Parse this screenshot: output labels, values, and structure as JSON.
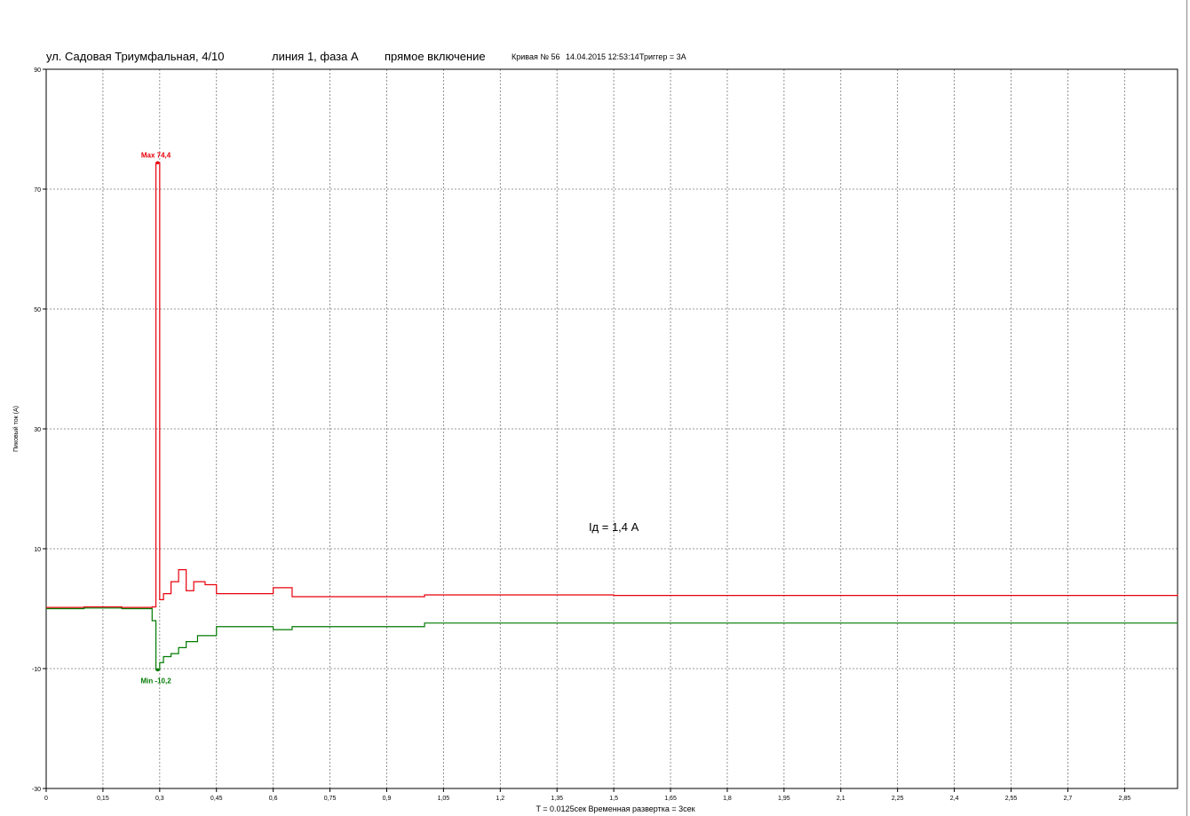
{
  "header": {
    "address": "ул. Садовая  Триумфальная, 4/10",
    "line_phase": "линия 1, фаза А",
    "mode": "прямое включение",
    "curve": "Кривая № 56",
    "datetime": "14.04.2015 12:53:14",
    "trigger": "Триггер = 3А"
  },
  "chart_data": {
    "type": "line",
    "ylabel": "Пиковый ток (А)",
    "xlabel": "T = 0.0125сек    Временная развертка = 3сек",
    "xlim": [
      0,
      2.99
    ],
    "ylim": [
      -30,
      90
    ],
    "x_ticks": [
      0,
      0.15,
      0.3,
      0.45,
      0.6,
      0.75,
      0.9,
      1.05,
      1.2,
      1.35,
      1.5,
      1.65,
      1.8,
      1.95,
      2.1,
      2.25,
      2.4,
      2.55,
      2.7,
      2.85
    ],
    "x_tick_labels": [
      "0",
      "0,15",
      "0,3",
      "0,45",
      "0,6",
      "0,75",
      "0,9",
      "1,05",
      "1,2",
      "1,35",
      "1,5",
      "1,65",
      "1,8",
      "1,95",
      "2,1",
      "2,25",
      "2,4",
      "2,55",
      "2,7",
      "2,85"
    ],
    "y_ticks": [
      -30,
      -10,
      10,
      30,
      50,
      70,
      90
    ],
    "y_tick_labels": [
      "-30",
      "-10",
      "10",
      "30",
      "50",
      "70",
      "90"
    ],
    "grid": true,
    "series": [
      {
        "color": "#e8000b",
        "values": [
          [
            0,
            0.2
          ],
          [
            0.1,
            0.3
          ],
          [
            0.2,
            0.2
          ],
          [
            0.28,
            0.3
          ],
          [
            0.29,
            74.4
          ],
          [
            0.3,
            1.5
          ],
          [
            0.31,
            2.5
          ],
          [
            0.33,
            4.5
          ],
          [
            0.35,
            6.5
          ],
          [
            0.37,
            3.0
          ],
          [
            0.39,
            4.5
          ],
          [
            0.42,
            4.0
          ],
          [
            0.45,
            2.5
          ],
          [
            0.55,
            2.5
          ],
          [
            0.6,
            3.5
          ],
          [
            0.65,
            2.0
          ],
          [
            1.0,
            2.3
          ],
          [
            1.5,
            2.2
          ],
          [
            2.0,
            2.2
          ],
          [
            2.5,
            2.2
          ],
          [
            2.99,
            2.4
          ]
        ]
      },
      {
        "color": "#007a00",
        "values": [
          [
            0,
            0.0
          ],
          [
            0.1,
            0.1
          ],
          [
            0.2,
            0.0
          ],
          [
            0.28,
            -2.0
          ],
          [
            0.29,
            -10.2
          ],
          [
            0.3,
            -9.0
          ],
          [
            0.31,
            -8.0
          ],
          [
            0.33,
            -7.5
          ],
          [
            0.35,
            -6.5
          ],
          [
            0.37,
            -5.5
          ],
          [
            0.4,
            -4.5
          ],
          [
            0.45,
            -3.0
          ],
          [
            0.6,
            -3.5
          ],
          [
            0.65,
            -3.0
          ],
          [
            1.0,
            -2.4
          ],
          [
            1.5,
            -2.4
          ],
          [
            2.0,
            -2.4
          ],
          [
            2.5,
            -2.4
          ],
          [
            2.99,
            -2.3
          ]
        ]
      }
    ],
    "annotations": [
      {
        "text": "Max 74,4",
        "x": 0.29,
        "y": 74.4,
        "color": "#e8000b"
      },
      {
        "text": "Min -10,2",
        "x": 0.29,
        "y": -10.2,
        "color": "#007a00"
      },
      {
        "text": "Iд = 1,4 A",
        "x": 1.5,
        "y": 13,
        "color": "#000000"
      }
    ]
  }
}
